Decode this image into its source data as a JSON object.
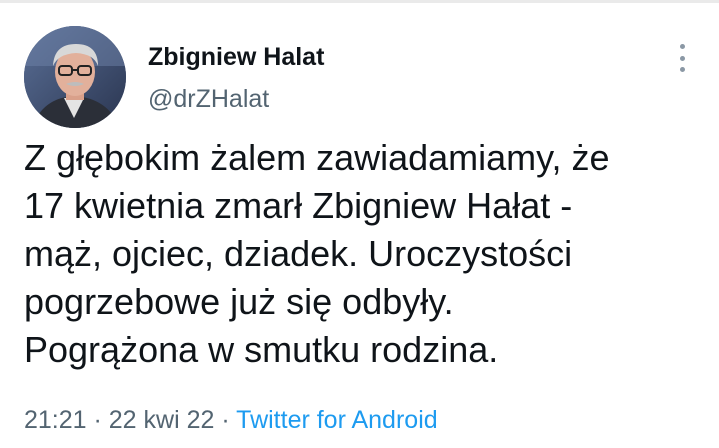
{
  "author": {
    "name": "Zbigniew Halat",
    "handle": "@drZHalat",
    "avatar": "author-avatar"
  },
  "more_icon": "more-vertical-icon",
  "tweet": {
    "lines": [
      "Z głębokim żalem zawiadamiamy, że",
      "17 kwietnia zmarł Zbigniew Hałat -",
      "mąż, ojciec, dziadek. Uroczystości",
      "pogrzebowe już się odbyły.",
      "Pogrążona w smutku rodzina."
    ]
  },
  "meta": {
    "time": "21:21",
    "separator": " · ",
    "date": "22 kwi 22",
    "source": "Twitter for Android"
  },
  "colors": {
    "text": "#0f1419",
    "secondary": "#536471",
    "link": "#1d9bf0"
  }
}
